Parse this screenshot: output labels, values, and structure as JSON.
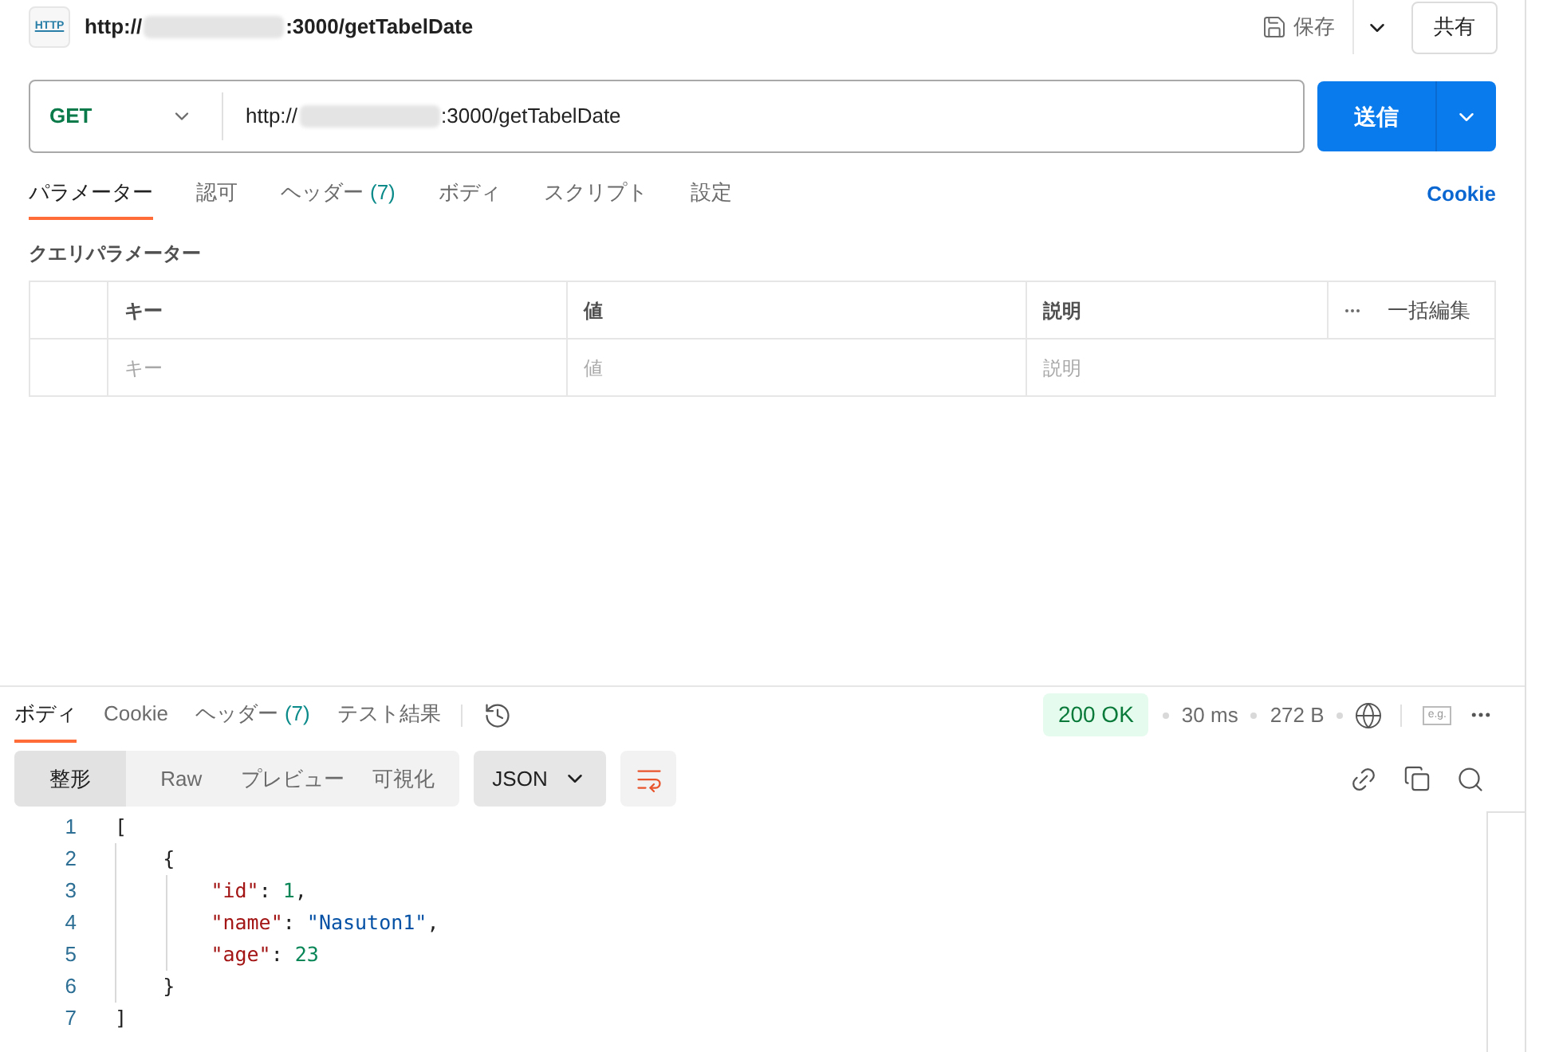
{
  "request": {
    "icon_label": "HTTP",
    "title_prefix": "http://",
    "title_suffix": ":3000/getTabelDate",
    "save": "保存",
    "share": "共有",
    "method": "GET",
    "url_prefix": "http://",
    "url_suffix": ":3000/getTabelDate",
    "send": "送信"
  },
  "request_tabs": [
    {
      "label": "パラメーター",
      "selected": true
    },
    {
      "label": "認可",
      "selected": false
    },
    {
      "label": "ヘッダー",
      "count": "(7)",
      "selected": false
    },
    {
      "label": "ボディ",
      "selected": false
    },
    {
      "label": "スクリプト",
      "selected": false
    },
    {
      "label": "設定",
      "selected": false
    }
  ],
  "cookie_link": "Cookie",
  "query": {
    "title": "クエリパラメーター",
    "columns": [
      "キー",
      "値",
      "説明"
    ],
    "bulk_edit": "一括編集",
    "placeholders": [
      "キー",
      "値",
      "説明"
    ]
  },
  "response": {
    "tabs": [
      {
        "label": "ボディ",
        "selected": true
      },
      {
        "label": "Cookie",
        "selected": false
      },
      {
        "label": "ヘッダー",
        "count": "(7)",
        "selected": false
      },
      {
        "label": "テスト結果",
        "selected": false
      }
    ],
    "status": "200 OK",
    "time": "30 ms",
    "size": "272 B",
    "example_label": "e.g.",
    "formats": [
      {
        "label": "整形",
        "selected": true
      },
      {
        "label": "Raw",
        "selected": false
      },
      {
        "label": "プレビュー",
        "selected": false
      },
      {
        "label": "可視化",
        "selected": false
      }
    ],
    "language": "JSON",
    "lines": [
      {
        "number": "1",
        "tokens": [
          {
            "kind": "punct",
            "text": "["
          }
        ]
      },
      {
        "number": "2",
        "tokens": [
          {
            "kind": "punct",
            "text": "    {"
          }
        ]
      },
      {
        "number": "3",
        "tokens": [
          {
            "kind": "key",
            "text": "        \"id\""
          },
          {
            "kind": "punct",
            "text": ": "
          },
          {
            "kind": "number",
            "text": "1"
          },
          {
            "kind": "punct",
            "text": ","
          }
        ]
      },
      {
        "number": "4",
        "tokens": [
          {
            "kind": "key",
            "text": "        \"name\""
          },
          {
            "kind": "punct",
            "text": ": "
          },
          {
            "kind": "string",
            "text": "\"Nasuton1\""
          },
          {
            "kind": "punct",
            "text": ","
          }
        ]
      },
      {
        "number": "5",
        "tokens": [
          {
            "kind": "key",
            "text": "        \"age\""
          },
          {
            "kind": "punct",
            "text": ": "
          },
          {
            "kind": "number",
            "text": "23"
          }
        ]
      },
      {
        "number": "6",
        "tokens": [
          {
            "kind": "punct",
            "text": "    }"
          }
        ]
      },
      {
        "number": "7",
        "tokens": [
          {
            "kind": "punct",
            "text": "]"
          }
        ]
      }
    ]
  }
}
